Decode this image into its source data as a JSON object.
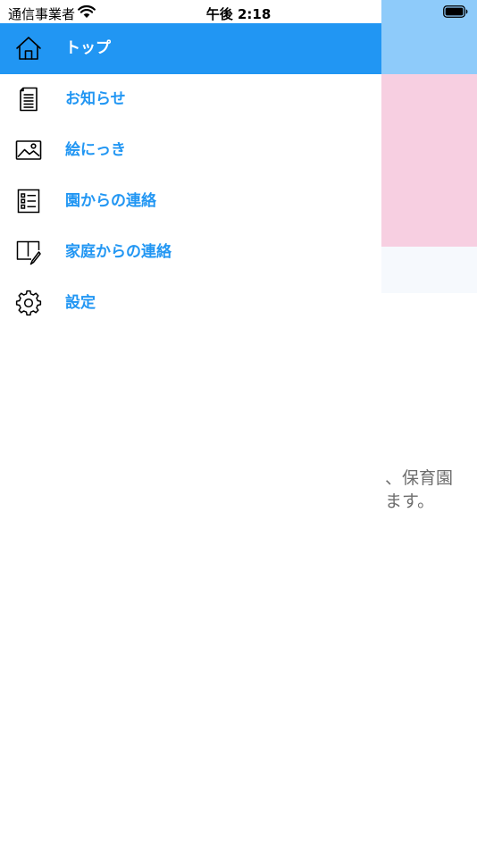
{
  "status_bar": {
    "carrier": "通信事業者",
    "time": "午後 2:18"
  },
  "drawer": {
    "items": [
      {
        "label": "トップ",
        "icon": "home-icon"
      },
      {
        "label": "お知らせ",
        "icon": "document-icon"
      },
      {
        "label": "絵にっき",
        "icon": "picture-icon"
      },
      {
        "label": "園からの連絡",
        "icon": "checklist-icon"
      },
      {
        "label": "家庭からの連絡",
        "icon": "note-pencil-icon"
      },
      {
        "label": "設定",
        "icon": "gear-icon"
      }
    ]
  },
  "background_page": {
    "text_line_1": "、保育園",
    "text_line_2": "ます。"
  },
  "colors": {
    "accent": "#2196f3",
    "header_bg": "#2196f3",
    "peek_blue": "#8ecbfa",
    "peek_pink": "#f7cfe1"
  }
}
